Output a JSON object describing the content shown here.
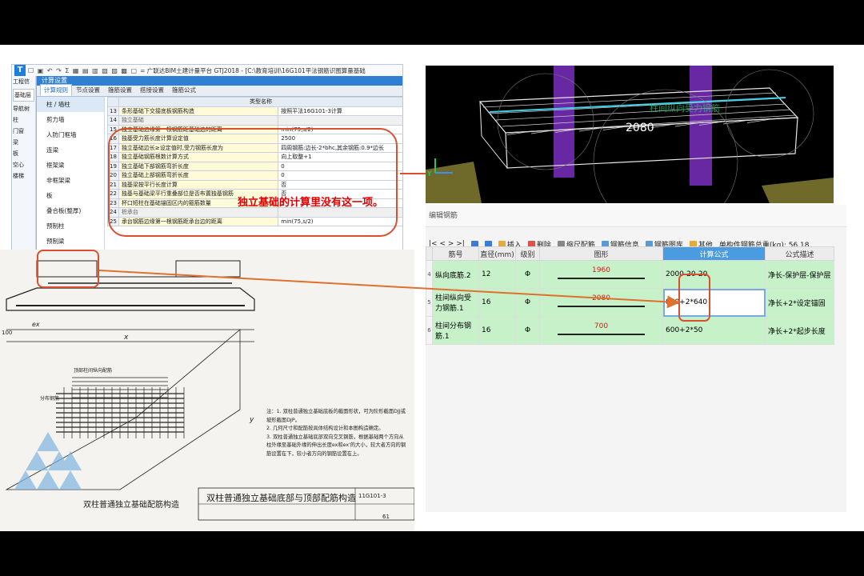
{
  "app": {
    "logo": "T",
    "quick_access": "☐ ▣ ↶ ↷ Σ ▦ ▤ ▥ ▧ ▨ ▩ ▢",
    "title": "= 广联达BIM土建计量平台 GTJ2018 - [C:\\教育培训\\16G101平法钢筋识图算量基础",
    "left_strip": [
      "工程信",
      "基础层",
      "导航树",
      "柱",
      "门窗",
      "梁",
      "板",
      "空心",
      "楼梯"
    ],
    "dialog_title": "计算设置",
    "tabs": [
      "计算规则",
      "节点设置",
      "箍筋设置",
      "搭接设置",
      "箍筋公式"
    ],
    "categories": [
      "柱 / 墙柱",
      "剪力墙",
      "人防门框墙",
      "连梁",
      "框架梁",
      "非框架梁",
      "板",
      "叠合板(整厚)",
      "预制柱",
      "预制梁"
    ],
    "grid_header": "类型名称",
    "rows": [
      {
        "num": "13",
        "name": "条形基础下交接底板钢筋构造",
        "value": "按照平法16G101-3计算",
        "section": false
      },
      {
        "num": "14",
        "name": "独立基础",
        "value": "",
        "section": true
      },
      {
        "num": "15",
        "name": "独立基础边缘第一根钢筋距基础边的距离",
        "value": "min(75,s/2)",
        "section": false
      },
      {
        "num": "16",
        "name": "独基受力筋长度计算设定值",
        "value": "2500",
        "section": false
      },
      {
        "num": "17",
        "name": "独立基础边长≥设定值时,受力钢筋长度为",
        "value": "四周钢筋:边长-2*bhc,其余钢筋:0.9*边长",
        "section": false
      },
      {
        "num": "18",
        "name": "独立基础钢筋根数计算方式",
        "value": "向上取整+1",
        "section": false
      },
      {
        "num": "19",
        "name": "独立基础下部钢筋弯折长度",
        "value": "0",
        "section": false
      },
      {
        "num": "20",
        "name": "独立基础上部钢筋弯折长度",
        "value": "0",
        "section": false
      },
      {
        "num": "21",
        "name": "独基梁按平行长度计算",
        "value": "否",
        "section": false
      },
      {
        "num": "22",
        "name": "独基与基础梁平行重叠部位是否布置独基钢筋",
        "value": "否",
        "section": false
      },
      {
        "num": "23",
        "name": "杯口短柱在基础锚固区内的箍筋数量",
        "value": "3",
        "section": false
      },
      {
        "num": "24",
        "name": "桩承台",
        "value": "",
        "section": true
      },
      {
        "num": "25",
        "name": "承台钢筋边缘第一根钢筋距承台边的距离",
        "value": "min(75,s/2)",
        "section": false
      }
    ]
  },
  "callout": "独立基础的计算里没有这一项。",
  "view3d": {
    "dim_label": "2080",
    "side_label": "柱间纵向受力钢筋",
    "axis_y": "Y"
  },
  "editor": {
    "title": "编辑钢筋",
    "toolbar": {
      "nav": "|< < > >|",
      "insert": "插入",
      "delete": "删除",
      "scale": "缩尺配筋",
      "info": "钢筋信息",
      "library": "钢筋图库",
      "other": "其他",
      "total": "单构件钢筋总重(kg): 56.18"
    },
    "columns": [
      "筋号",
      "直径(mm)",
      "级别",
      "图形",
      "计算公式",
      "公式描述"
    ],
    "rows": [
      {
        "ix": "4",
        "name": "纵向底筋.2",
        "dia": "12",
        "grade": "Φ",
        "shape": "1960",
        "formula": "2000-20-20",
        "desc": "净长-保护层-保护层"
      },
      {
        "ix": "5",
        "name": "柱间纵向受力钢筋.1",
        "dia": "16",
        "grade": "Φ",
        "shape": "2080",
        "formula": "800+2*640",
        "desc": "净长+2*设定锚固"
      },
      {
        "ix": "6",
        "name": "柱间分布钢筋.1",
        "dia": "16",
        "grade": "Φ",
        "shape": "700",
        "formula": "600+2*50",
        "desc": "净长+2*起步长度"
      }
    ]
  },
  "drawing": {
    "title": "双柱普通独立基础底部与顶部配筋构造",
    "caption": "双柱普通独立基础配筋构造",
    "atlas": "11G101-3",
    "page": "61",
    "top_label": "顶部柱间纵向配筋",
    "side_label": "分布钢筋",
    "dim_x": "x",
    "dim_y": "y",
    "dim_ex": "ex",
    "dim_100": "100",
    "notes": [
      "注：1. 双柱普通独立基础底板的截面形状，可为阶形截面DJJ或坡形截面DJP。",
      "2. 几何尺寸和配筋按具体结构设计和本图构造确定。",
      "3. 双柱普通独立基础底部双向交叉钢筋，根据基础两个方向从柱外缘至基础外缘的伸出长度ex和ex'的大小，较大者方向的钢筋设置在下，较小者方向的钢筋设置在上。"
    ]
  }
}
